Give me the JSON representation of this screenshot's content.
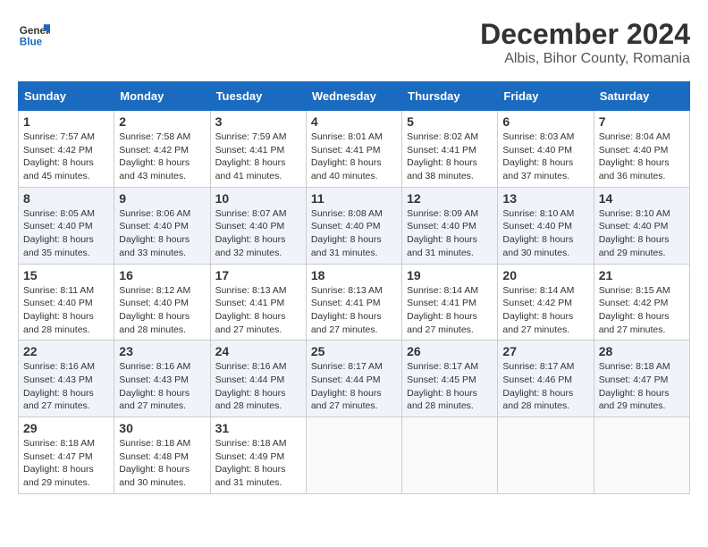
{
  "logo": {
    "line1": "General",
    "line2": "Blue"
  },
  "title": "December 2024",
  "subtitle": "Albis, Bihor County, Romania",
  "days_of_week": [
    "Sunday",
    "Monday",
    "Tuesday",
    "Wednesday",
    "Thursday",
    "Friday",
    "Saturday"
  ],
  "weeks": [
    [
      {
        "day": "1",
        "sunrise": "7:57 AM",
        "sunset": "4:42 PM",
        "daylight": "8 hours and 45 minutes."
      },
      {
        "day": "2",
        "sunrise": "7:58 AM",
        "sunset": "4:42 PM",
        "daylight": "8 hours and 43 minutes."
      },
      {
        "day": "3",
        "sunrise": "7:59 AM",
        "sunset": "4:41 PM",
        "daylight": "8 hours and 41 minutes."
      },
      {
        "day": "4",
        "sunrise": "8:01 AM",
        "sunset": "4:41 PM",
        "daylight": "8 hours and 40 minutes."
      },
      {
        "day": "5",
        "sunrise": "8:02 AM",
        "sunset": "4:41 PM",
        "daylight": "8 hours and 38 minutes."
      },
      {
        "day": "6",
        "sunrise": "8:03 AM",
        "sunset": "4:40 PM",
        "daylight": "8 hours and 37 minutes."
      },
      {
        "day": "7",
        "sunrise": "8:04 AM",
        "sunset": "4:40 PM",
        "daylight": "8 hours and 36 minutes."
      }
    ],
    [
      {
        "day": "8",
        "sunrise": "8:05 AM",
        "sunset": "4:40 PM",
        "daylight": "8 hours and 35 minutes."
      },
      {
        "day": "9",
        "sunrise": "8:06 AM",
        "sunset": "4:40 PM",
        "daylight": "8 hours and 33 minutes."
      },
      {
        "day": "10",
        "sunrise": "8:07 AM",
        "sunset": "4:40 PM",
        "daylight": "8 hours and 32 minutes."
      },
      {
        "day": "11",
        "sunrise": "8:08 AM",
        "sunset": "4:40 PM",
        "daylight": "8 hours and 31 minutes."
      },
      {
        "day": "12",
        "sunrise": "8:09 AM",
        "sunset": "4:40 PM",
        "daylight": "8 hours and 31 minutes."
      },
      {
        "day": "13",
        "sunrise": "8:10 AM",
        "sunset": "4:40 PM",
        "daylight": "8 hours and 30 minutes."
      },
      {
        "day": "14",
        "sunrise": "8:10 AM",
        "sunset": "4:40 PM",
        "daylight": "8 hours and 29 minutes."
      }
    ],
    [
      {
        "day": "15",
        "sunrise": "8:11 AM",
        "sunset": "4:40 PM",
        "daylight": "8 hours and 28 minutes."
      },
      {
        "day": "16",
        "sunrise": "8:12 AM",
        "sunset": "4:40 PM",
        "daylight": "8 hours and 28 minutes."
      },
      {
        "day": "17",
        "sunrise": "8:13 AM",
        "sunset": "4:41 PM",
        "daylight": "8 hours and 27 minutes."
      },
      {
        "day": "18",
        "sunrise": "8:13 AM",
        "sunset": "4:41 PM",
        "daylight": "8 hours and 27 minutes."
      },
      {
        "day": "19",
        "sunrise": "8:14 AM",
        "sunset": "4:41 PM",
        "daylight": "8 hours and 27 minutes."
      },
      {
        "day": "20",
        "sunrise": "8:14 AM",
        "sunset": "4:42 PM",
        "daylight": "8 hours and 27 minutes."
      },
      {
        "day": "21",
        "sunrise": "8:15 AM",
        "sunset": "4:42 PM",
        "daylight": "8 hours and 27 minutes."
      }
    ],
    [
      {
        "day": "22",
        "sunrise": "8:16 AM",
        "sunset": "4:43 PM",
        "daylight": "8 hours and 27 minutes."
      },
      {
        "day": "23",
        "sunrise": "8:16 AM",
        "sunset": "4:43 PM",
        "daylight": "8 hours and 27 minutes."
      },
      {
        "day": "24",
        "sunrise": "8:16 AM",
        "sunset": "4:44 PM",
        "daylight": "8 hours and 28 minutes."
      },
      {
        "day": "25",
        "sunrise": "8:17 AM",
        "sunset": "4:44 PM",
        "daylight": "8 hours and 27 minutes."
      },
      {
        "day": "26",
        "sunrise": "8:17 AM",
        "sunset": "4:45 PM",
        "daylight": "8 hours and 28 minutes."
      },
      {
        "day": "27",
        "sunrise": "8:17 AM",
        "sunset": "4:46 PM",
        "daylight": "8 hours and 28 minutes."
      },
      {
        "day": "28",
        "sunrise": "8:18 AM",
        "sunset": "4:47 PM",
        "daylight": "8 hours and 29 minutes."
      }
    ],
    [
      {
        "day": "29",
        "sunrise": "8:18 AM",
        "sunset": "4:47 PM",
        "daylight": "8 hours and 29 minutes."
      },
      {
        "day": "30",
        "sunrise": "8:18 AM",
        "sunset": "4:48 PM",
        "daylight": "8 hours and 30 minutes."
      },
      {
        "day": "31",
        "sunrise": "8:18 AM",
        "sunset": "4:49 PM",
        "daylight": "8 hours and 31 minutes."
      },
      null,
      null,
      null,
      null
    ]
  ],
  "labels": {
    "sunrise": "Sunrise:",
    "sunset": "Sunset:",
    "daylight": "Daylight:"
  }
}
